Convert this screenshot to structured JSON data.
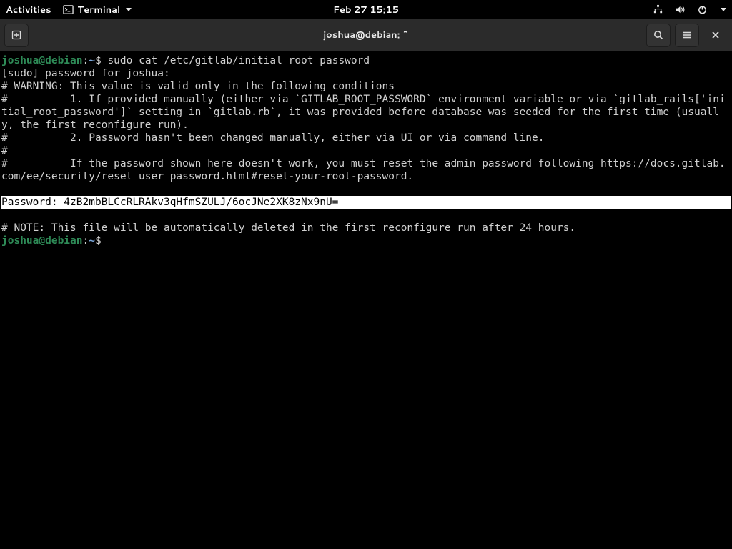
{
  "panel": {
    "activities": "Activities",
    "app_name": "Terminal",
    "clock": "Feb 27  15:15"
  },
  "window": {
    "title": "joshua@debian: ~"
  },
  "prompt": {
    "user_host": "joshua@debian",
    "sep": ":",
    "path": "~",
    "dollar": "$ "
  },
  "terminal": {
    "cmd1": "sudo cat /etc/gitlab/initial_root_password",
    "out": [
      "[sudo] password for joshua:",
      "# WARNING: This value is valid only in the following conditions",
      "#          1. If provided manually (either via `GITLAB_ROOT_PASSWORD` environment variable or via `gitlab_rails['initial_root_password']` setting in `gitlab.rb`, it was provided before database was seeded for the first time (usually, the first reconfigure run).",
      "#          2. Password hasn't been changed manually, either via UI or via command line.",
      "#",
      "#          If the password shown here doesn't work, you must reset the admin password following https://docs.gitlab.com/ee/security/reset_user_password.html#reset-your-root-password.",
      ""
    ],
    "password_line": "Password: 4zB2mbBLCcRLRAkv3qHfmSZULJ/6ocJNe2XK8zNx9nU=",
    "note_blank": "",
    "note": "# NOTE: This file will be automatically deleted in the first reconfigure run after 24 hours."
  }
}
